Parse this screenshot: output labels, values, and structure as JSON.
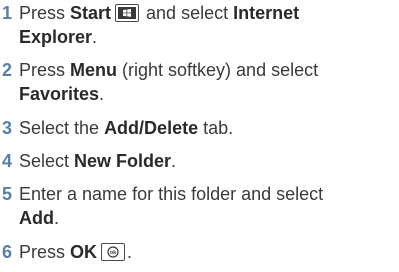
{
  "steps": [
    {
      "number": "1",
      "line1": {
        "a": "Press ",
        "b": "Start",
        "c": " and select ",
        "d": "Internet"
      },
      "line2": {
        "b": "Explorer",
        "c": "."
      },
      "icon": "windows-start-key-icon"
    },
    {
      "number": "2",
      "line1": {
        "a": "Press ",
        "b": "Menu",
        "c": " (right softkey) and select"
      },
      "line2": {
        "b": "Favorites",
        "c": "."
      }
    },
    {
      "number": "3",
      "line1": {
        "a": "Select the ",
        "b": "Add/Delete",
        "c": " tab."
      }
    },
    {
      "number": "4",
      "line1": {
        "a": "Select ",
        "b": "New Folder",
        "c": "."
      }
    },
    {
      "number": "5",
      "line1": {
        "a": "Enter a name for this folder and select"
      },
      "line2": {
        "b": "Add",
        "c": "."
      }
    },
    {
      "number": "6",
      "line1": {
        "a": "Press ",
        "b": "OK",
        "c": "."
      },
      "icon": "ok-key-icon"
    }
  ]
}
